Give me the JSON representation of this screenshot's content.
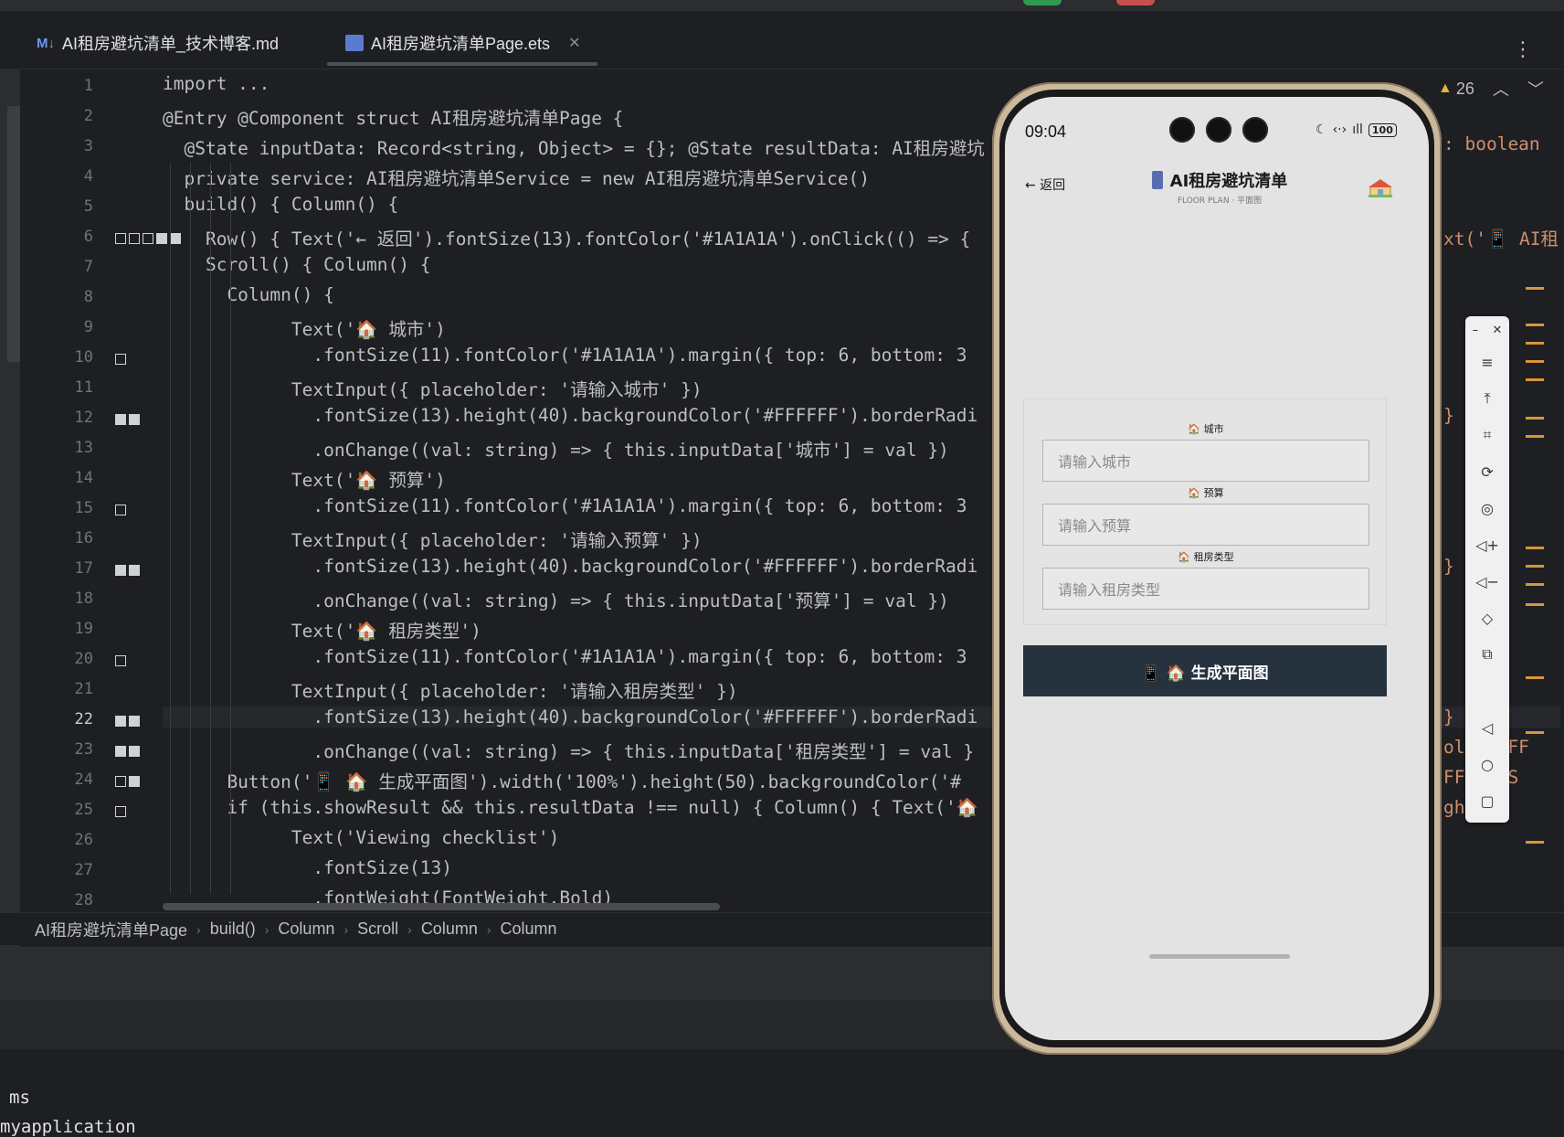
{
  "tabs": [
    {
      "icon": "markdown-icon",
      "label": "AI租房避坑清单_技术博客.md",
      "active": false
    },
    {
      "icon": "ets-file-icon",
      "label": "AI租房避坑清单Page.ets",
      "active": true
    }
  ],
  "warnings": {
    "count": "26"
  },
  "code": {
    "current_line": 22,
    "lines": [
      {
        "n": "1",
        "text": "import ..."
      },
      {
        "n": "2",
        "text": "@Entry @Component struct AI租房避坑清单Page {"
      },
      {
        "n": "3",
        "text": "  @State inputData: Record<string, Object> = {}; @State resultData: AI租房避坑"
      },
      {
        "n": "4",
        "text": "  private service: AI租房避坑清单Service = new AI租房避坑清单Service()"
      },
      {
        "n": "5",
        "text": "  build() { Column() {"
      },
      {
        "n": "6",
        "text": "    Row() { Text('← 返回').fontSize(13).fontColor('#1A1A1A').onClick(() => {"
      },
      {
        "n": "7",
        "text": "    Scroll() { Column() {"
      },
      {
        "n": "8",
        "text": "      Column() {"
      },
      {
        "n": "9",
        "text": "            Text('🏠 城市')"
      },
      {
        "n": "10",
        "text": "              .fontSize(11).fontColor('#1A1A1A').margin({ top: 6, bottom: 3"
      },
      {
        "n": "11",
        "text": "            TextInput({ placeholder: '请输入城市' })"
      },
      {
        "n": "12",
        "text": "              .fontSize(13).height(40).backgroundColor('#FFFFFF').borderRadi"
      },
      {
        "n": "13",
        "text": "              .onChange((val: string) => { this.inputData['城市'] = val })"
      },
      {
        "n": "14",
        "text": "            Text('🏠 预算')"
      },
      {
        "n": "15",
        "text": "              .fontSize(11).fontColor('#1A1A1A').margin({ top: 6, bottom: 3"
      },
      {
        "n": "16",
        "text": "            TextInput({ placeholder: '请输入预算' })"
      },
      {
        "n": "17",
        "text": "              .fontSize(13).height(40).backgroundColor('#FFFFFF').borderRadi"
      },
      {
        "n": "18",
        "text": "              .onChange((val: string) => { this.inputData['预算'] = val })"
      },
      {
        "n": "19",
        "text": "            Text('🏠 租房类型')"
      },
      {
        "n": "20",
        "text": "              .fontSize(11).fontColor('#1A1A1A').margin({ top: 6, bottom: 3"
      },
      {
        "n": "21",
        "text": "            TextInput({ placeholder: '请输入租房类型' })"
      },
      {
        "n": "22",
        "text": "              .fontSize(13).height(40).backgroundColor('#FFFFFF').borderRadi"
      },
      {
        "n": "23",
        "text": "              .onChange((val: string) => { this.inputData['租房类型'] = val }"
      },
      {
        "n": "24",
        "text": "      Button('📱 🏠 生成平面图').width('100%').height(50).backgroundColor('#"
      },
      {
        "n": "25",
        "text": "      if (this.showResult && this.resultData !== null) { Column() { Text('🏠"
      },
      {
        "n": "26",
        "text": "            Text('Viewing checklist')"
      },
      {
        "n": "27",
        "text": "              .fontSize(13)"
      },
      {
        "n": "28",
        "text": "              .fontWeight(FontWeight.Bold)"
      }
    ],
    "right_fragments": [
      {
        "line": "3",
        "text": ": boolean"
      },
      {
        "line": "6",
        "text": "xt('📱 AI租"
      },
      {
        "line": "12",
        "text": "} ddi"
      },
      {
        "line": "17",
        "text": "} ddi"
      },
      {
        "line": "22",
        "text": "} ddi"
      },
      {
        "line": "23",
        "text": "olo #FFF"
      },
      {
        "line": "24",
        "text": "FF ontS"
      },
      {
        "line": "25",
        "text": "ght d)"
      }
    ]
  },
  "breadcrumb": [
    "AI租房避坑清单Page",
    "build()",
    "Column",
    "Scroll",
    "Column",
    "Column"
  ],
  "terminal": [
    "ms",
    "myapplication"
  ],
  "phone": {
    "time": "09:04",
    "battery": "100",
    "back_label": "← 返回",
    "title": "AI租房避坑清单",
    "subtitle": "FLOOR PLAN · 平面图",
    "fields": [
      {
        "label": "🏠 城市",
        "placeholder": "请输入城市"
      },
      {
        "label": "🏠 预算",
        "placeholder": "请输入预算"
      },
      {
        "label": "🏠 租房类型",
        "placeholder": "请输入租房类型"
      }
    ],
    "generate_label": "📱 🏠 生成平面图",
    "button_color": "#27323F"
  },
  "emulator_tools": [
    "minimize",
    "close",
    "menu",
    "pin-top",
    "crop",
    "rotate",
    "screenshot",
    "volume-up",
    "volume-down",
    "shake",
    "multi-window",
    "back",
    "home",
    "recent"
  ]
}
